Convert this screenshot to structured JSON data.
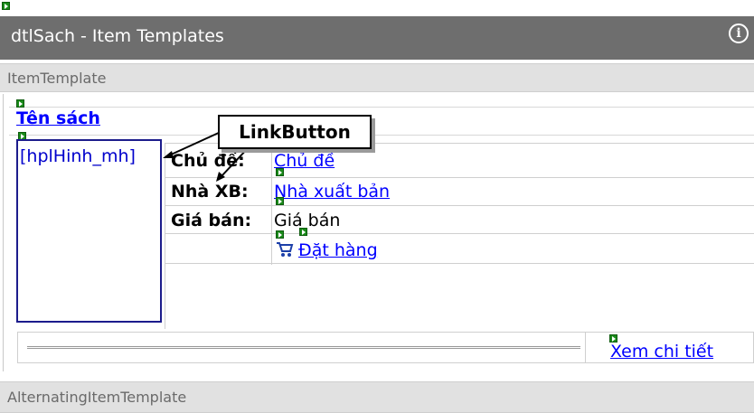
{
  "window": {
    "title": "dtlSach - Item Templates",
    "info_icon": "info-icon"
  },
  "sections": {
    "item_template": "ItemTemplate",
    "alternating_template": "AlternatingItemTemplate"
  },
  "item": {
    "title_link": "Tên sách",
    "image_placeholder": "[hplHinh_mh]",
    "rows": [
      {
        "label": "Chủ đề:",
        "value": "Chủ đề",
        "is_link": true
      },
      {
        "label": "Nhà XB:",
        "value": "Nhà xuất bản",
        "is_link": true
      },
      {
        "label": "Giá bán:",
        "value": "Giá bán",
        "is_link": false
      }
    ],
    "order_link": "Đặt hàng",
    "cart_icon": "cart-icon",
    "detail_link": "Xem chi tiết"
  },
  "annotation": {
    "callout": "LinkButton"
  },
  "colors": {
    "title_bar": "#6e6e6e",
    "section_bar": "#e1e1e1",
    "link": "#0000ff",
    "marker": "#1a8a1a"
  }
}
